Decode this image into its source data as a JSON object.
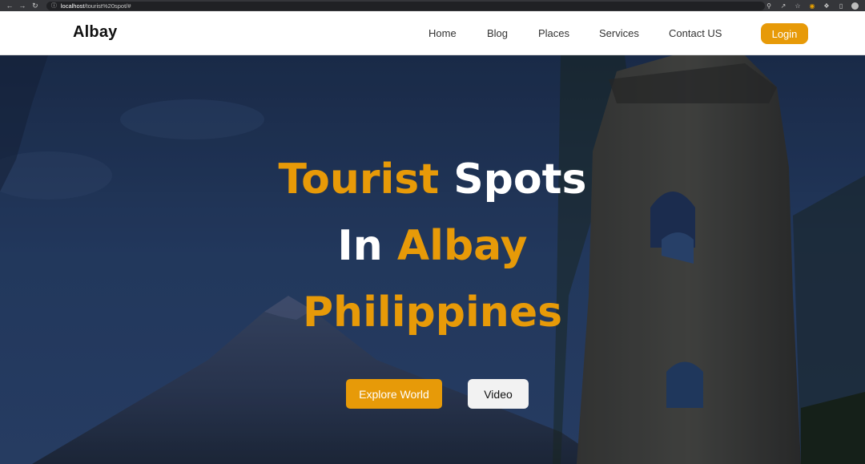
{
  "browser": {
    "url_host": "localhost",
    "url_path": "/tourist%20spot/#",
    "icons": {
      "back": "back-arrow-icon",
      "forward": "forward-arrow-icon",
      "reload": "reload-icon",
      "lock": "info-icon",
      "zoom": "zoom-icon",
      "share": "share-icon",
      "bookmark": "star-icon",
      "extension": "extension-icon",
      "puzzle": "puzzle-icon",
      "sidebar": "sidebar-icon",
      "profile": "profile-avatar"
    }
  },
  "header": {
    "logo": "Albay",
    "nav": [
      "Home",
      "Blog",
      "Places",
      "Services",
      "Contact US"
    ],
    "login_label": "Login"
  },
  "hero": {
    "line1": {
      "a": "Tourist",
      "b": "Spots"
    },
    "line2": {
      "a": "In",
      "b": "Albay"
    },
    "line3": "Philippines",
    "explore_label": "Explore World",
    "video_label": "Video"
  },
  "colors": {
    "accent": "#e79a08",
    "header_bg": "#ffffff",
    "hero_sky": "#243c62",
    "title_white": "#ffffff",
    "video_btn_bg": "#f2f2f2"
  }
}
